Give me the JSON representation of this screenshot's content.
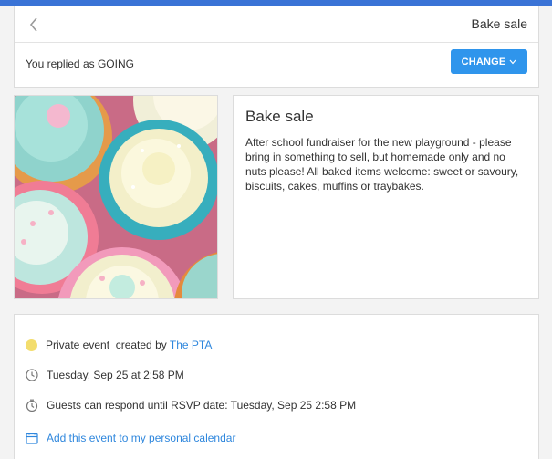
{
  "header": {
    "title": "Bake sale"
  },
  "reply": {
    "status_text": "You replied as GOING",
    "change_label": "CHANGE"
  },
  "event": {
    "title": "Bake sale",
    "description": "After school fundraiser for the new playground - please bring in something to sell, but homemade only and no nuts please! All baked items welcome: sweet or savoury, biscuits, cakes, muffins or traybakes."
  },
  "details": {
    "privacy_prefix": "Private event  created by",
    "creator": "The PTA",
    "datetime": "Tuesday, Sep 25 at 2:58 PM",
    "rsvp": "Guests can respond until RSVP date: Tuesday, Sep 25 2:58 PM",
    "calendar_link": "Add this event to my personal calendar"
  },
  "colors": {
    "accent": "#2f95ec",
    "link": "#2f87dd",
    "topbar": "#3a73d6",
    "privacy_dot": "#f3dd6d"
  },
  "icons": {
    "back": "chevron-left-icon",
    "change_dropdown": "chevron-down-icon",
    "privacy": "yellow-dot-icon",
    "datetime": "clock-icon",
    "rsvp": "timer-icon",
    "calendar": "calendar-icon"
  }
}
